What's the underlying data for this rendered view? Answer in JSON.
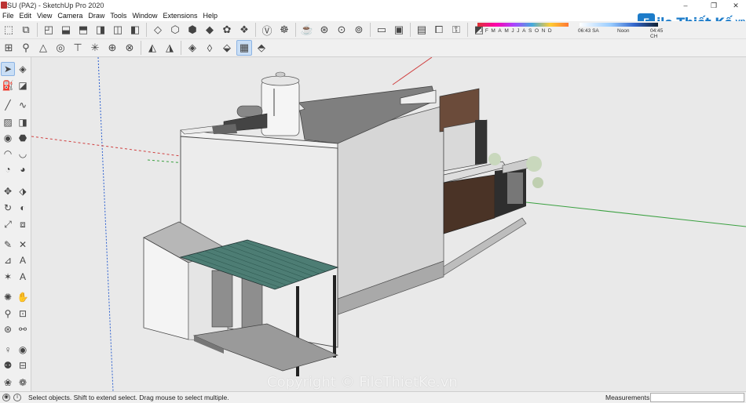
{
  "window": {
    "title": "SU (PA2) - SketchUp Pro 2020",
    "minimize_glyph": "–",
    "maximize_glyph": "❐",
    "close_glyph": "✕"
  },
  "menu": [
    "File",
    "Edit",
    "View",
    "Camera",
    "Draw",
    "Tools",
    "Window",
    "Extensions",
    "Help"
  ],
  "shadows": {
    "months": "JFMAMJJASOND",
    "time_start": "06:43 SA",
    "time_mid": "Noon",
    "time_end": "04:45 CH"
  },
  "logo": {
    "box_text": "F",
    "brand": "ile Thiết Kế",
    "suffix": ".vn"
  },
  "toolbar_icons_row1": [
    "select-icon",
    "component-icon",
    "iso-view-icon",
    "top-view-icon",
    "front-view-icon",
    "right-view-icon",
    "back-view-icon",
    "left-view-icon",
    "xray-icon",
    "back-edges-icon",
    "wireframe-icon",
    "hidden-line-icon",
    "shaded-icon",
    "shaded-textures-icon",
    "monochrome-icon",
    "3d-warehouse-icon",
    "extension-warehouse-icon",
    "layout-icon",
    "section-plane-icon",
    "section-cut-icon",
    "section-fill-icon",
    "scene-icon",
    "camera-icon",
    "walk-icon",
    "lock-icon"
  ],
  "toolbar_icons_row2": [
    "dimension-icon",
    "protractor-icon",
    "tape-icon",
    "axes-icon",
    "text-icon",
    "3d-text-icon",
    "solid-union-icon",
    "solid-subtract-icon",
    "solid-trim-icon",
    "solid-split-icon",
    "outer-shell-icon",
    "intersect-icon",
    "sandbox-icon",
    "smoove-icon",
    "stamp-icon",
    "drape-icon"
  ],
  "status": {
    "message": "Select objects. Shift to extend select. Drag mouse to select multiple.",
    "measurements_label": "Measurements",
    "measurements_value": ""
  },
  "watermark": "Copyright © FileThietKe.vn"
}
